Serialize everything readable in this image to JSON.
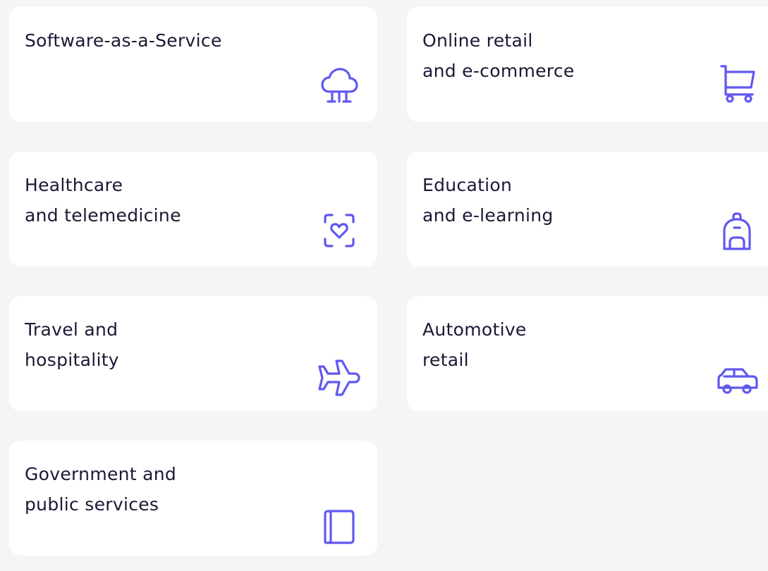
{
  "accent_color": "#6058f0",
  "text_color": "#1b1934",
  "background_color": "#f5f5f5",
  "industries": [
    {
      "lines": [
        "Software-as-a-Service"
      ],
      "icon": "cloud-icon"
    },
    {
      "lines": [
        "Online retail",
        "and e-commerce"
      ],
      "icon": "shopping-cart-icon"
    },
    {
      "lines": [
        "Healthcare",
        "and telemedicine"
      ],
      "icon": "heart-scan-icon"
    },
    {
      "lines": [
        "Education",
        "and e-learning"
      ],
      "icon": "backpack-icon"
    },
    {
      "lines": [
        "Travel and",
        "hospitality"
      ],
      "icon": "airplane-icon"
    },
    {
      "lines": [
        "Automotive",
        "retail"
      ],
      "icon": "car-icon"
    },
    {
      "lines": [
        "Government and",
        "public services"
      ],
      "icon": "scroll-icon"
    }
  ]
}
